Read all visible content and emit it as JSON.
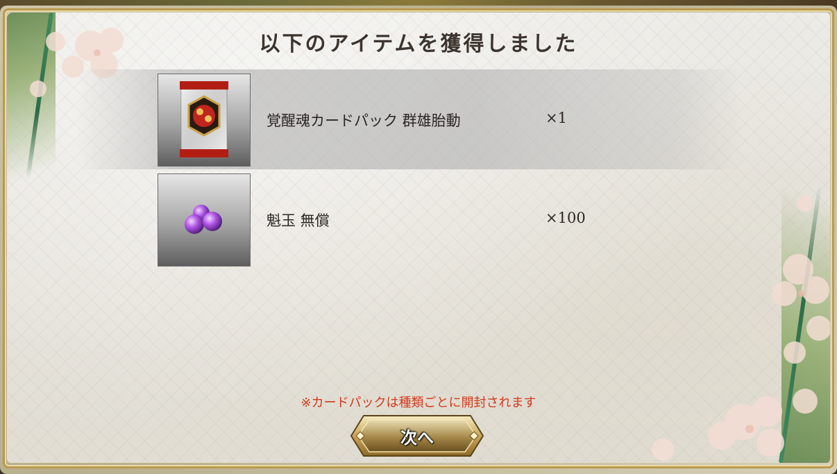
{
  "dialog": {
    "title": "以下のアイテムを獲得しました",
    "note": "※カードパックは種類ごとに開封されます",
    "next_button_label": "次へ"
  },
  "items": [
    {
      "name": "覚醒魂カードパック 群雄胎動",
      "quantity": "×1",
      "icon": "card-pack-icon",
      "highlighted": true
    },
    {
      "name": "魁玉 無償",
      "quantity": "×100",
      "icon": "purple-gem-icon",
      "highlighted": false
    }
  ],
  "colors": {
    "note": "#d23a1c",
    "title": "#3c342e",
    "accent_gold": "#b99a4e"
  }
}
